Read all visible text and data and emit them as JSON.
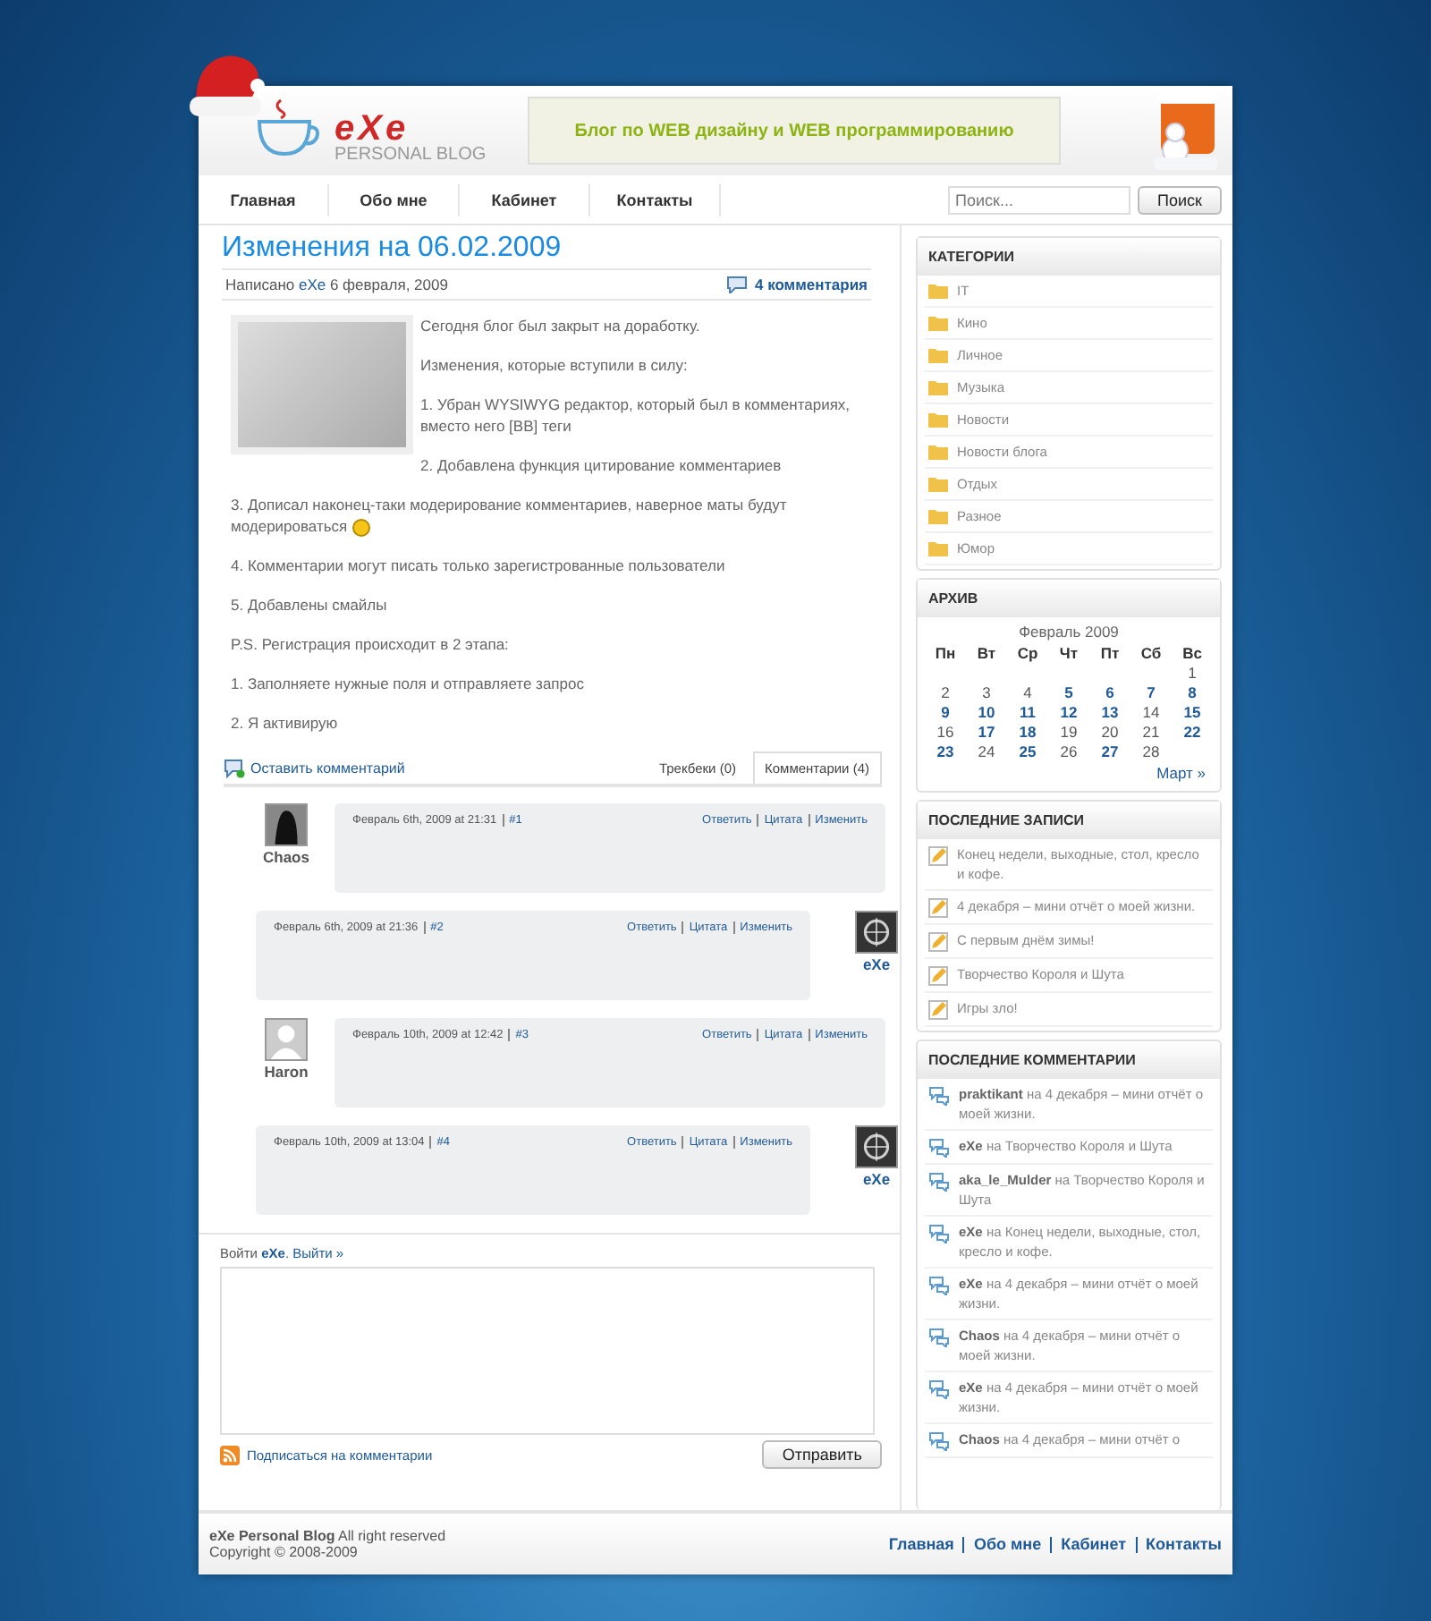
{
  "header": {
    "logo_title": "eXe",
    "logo_subtitle": "PERSONAL BLOG",
    "banner": "Блог по WEB дизайну и WEB программированию"
  },
  "nav": [
    "Главная",
    "Обо мне",
    "Кабинет",
    "Контакты"
  ],
  "search": {
    "placeholder": "Поиск...",
    "button": "Поиск"
  },
  "post": {
    "title": "Изменения на 06.02.2009",
    "meta_prefix": "Написано",
    "author": "eXe",
    "date": "6 февраля, 2009",
    "comments_link": "4 комментария",
    "beside_image": [
      {
        "text": "Сегодня блог был закрыт на доработку.",
        "smiley": false
      },
      {
        "text": "Изменения, которые вступили в силу:",
        "smiley": false
      },
      {
        "text": "1. Убран WYSIWYG редактор, который был в комментариях, вместо него [BB] теги",
        "smiley": false
      },
      {
        "text": "2. Добавлена функция цитирование комментариев",
        "smiley": false
      }
    ],
    "below_image": [
      {
        "text": "3. Дописал наконец-таки модерирование комментариев, наверное маты будут модерироваться",
        "smiley": true
      },
      {
        "text": "4. Комментарии могут писать только зарегистрованные пользователи",
        "smiley": false
      },
      {
        "text": "5. Добавлены смайлы",
        "smiley": false
      },
      {
        "text": "P.S. Регистрация происходит в 2 этапа:",
        "smiley": false
      },
      {
        "text": "1. Заполняете нужные поля и отправляете запрос",
        "smiley": false
      },
      {
        "text": "2. Я активирую",
        "smiley": false
      }
    ]
  },
  "leave_comment": "Оставить комментарий",
  "tabs": [
    {
      "label": "Трекбеки (0)",
      "selected": false
    },
    {
      "label": "Комментарии (4)",
      "selected": true
    }
  ],
  "comments": [
    {
      "author": "Chaos",
      "kind": "visitor",
      "date": "Февраль 6th, 2009 at 21:31",
      "number": "#1",
      "actions": [
        "Ответить",
        "Цитата",
        "Изменить"
      ]
    },
    {
      "author": "eXe",
      "kind": "owner",
      "date": "Февраль 6th, 2009 at 21:36",
      "number": "#2",
      "actions": [
        "Ответить",
        "Цитата",
        "Изменить"
      ]
    },
    {
      "author": "Haron",
      "kind": "anonymous",
      "date": "Февраль 10th, 2009 at 12:42",
      "number": "#3",
      "actions": [
        "Ответить",
        "Цитата",
        "Изменить"
      ]
    },
    {
      "author": "eXe",
      "kind": "owner",
      "date": "Февраль 10th, 2009 at 13:04",
      "number": "#4",
      "actions": [
        "Ответить",
        "Цитата",
        "Изменить"
      ]
    }
  ],
  "reply_form": {
    "login_prefix": "Войти",
    "user": "eXe",
    "user_suffix": ".",
    "logout": "Выйти »",
    "subscribe": "Подписаться на комментарии",
    "submit": "Отправить"
  },
  "categories": {
    "title": "КАТЕГОРИИ",
    "items": [
      "IT",
      "Кино",
      "Личное",
      "Музыка",
      "Новости",
      "Новости блога",
      "Отдых",
      "Разное",
      "Юмор"
    ]
  },
  "archive": {
    "title": "АРХИВ",
    "month": "Февраль 2009",
    "weekdays": [
      "Пн",
      "Вт",
      "Ср",
      "Чт",
      "Пт",
      "Сб",
      "Вс"
    ],
    "weeks": [
      [
        {
          "day": "1",
          "linked": false
        }
      ],
      [
        {
          "day": "2",
          "linked": false
        },
        {
          "day": "3",
          "linked": false
        },
        {
          "day": "4",
          "linked": false
        },
        {
          "day": "5",
          "linked": true
        },
        {
          "day": "6",
          "linked": true
        },
        {
          "day": "7",
          "linked": true
        },
        {
          "day": "8",
          "linked": true
        }
      ],
      [
        {
          "day": "9",
          "linked": true
        },
        {
          "day": "10",
          "linked": true
        },
        {
          "day": "11",
          "linked": true
        },
        {
          "day": "12",
          "linked": true
        },
        {
          "day": "13",
          "linked": true
        },
        {
          "day": "14",
          "linked": false
        },
        {
          "day": "15",
          "linked": true
        }
      ],
      [
        {
          "day": "16",
          "linked": false
        },
        {
          "day": "17",
          "linked": true
        },
        {
          "day": "18",
          "linked": true
        },
        {
          "day": "19",
          "linked": false
        },
        {
          "day": "20",
          "linked": false
        },
        {
          "day": "21",
          "linked": false
        },
        {
          "day": "22",
          "linked": true
        }
      ],
      [
        {
          "day": "23",
          "linked": true
        },
        {
          "day": "24",
          "linked": false
        },
        {
          "day": "25",
          "linked": true
        },
        {
          "day": "26",
          "linked": false
        },
        {
          "day": "27",
          "linked": true
        },
        {
          "day": "28",
          "linked": false
        }
      ]
    ],
    "next": "Март »"
  },
  "recent_posts": {
    "title": "ПОСЛЕДНИЕ ЗАПИСИ",
    "items": [
      "Конец недели, выходные, стол, кресло и кофе.",
      "4 декабря – мини отчёт о моей жизни.",
      "С первым днём зимы!",
      "Творчество Короля и Шута",
      "Игры зло!"
    ]
  },
  "recent_comments": {
    "title": "ПОСЛЕДНИЕ КОММЕНТАРИИ",
    "items": [
      {
        "author": "praktikant",
        "text": "на 4 декабря – мини отчёт о моей жизни."
      },
      {
        "author": "eXe",
        "text": "на Творчество Короля и Шута"
      },
      {
        "author": "aka_le_Mulder",
        "text": "на Творчество Короля и Шута"
      },
      {
        "author": "eXe",
        "text": "на Конец недели, выходные, стол, кресло и кофе."
      },
      {
        "author": "eXe",
        "text": "на 4 декабря – мини отчёт о моей жизни."
      },
      {
        "author": "Chaos",
        "text": "на 4 декабря – мини отчёт о моей жизни."
      },
      {
        "author": "eXe",
        "text": "на 4 декабря – мини отчёт о моей жизни."
      },
      {
        "author": "Chaos",
        "text": "на 4 декабря – мини отчёт о"
      }
    ]
  },
  "footer": {
    "blog_name": "eXe Personal Blog",
    "rights": "All right reserved",
    "copyright": "Copyright © 2008-2009",
    "links": [
      "Главная",
      "Обо мне",
      "Кабинет",
      "Контакты"
    ]
  }
}
